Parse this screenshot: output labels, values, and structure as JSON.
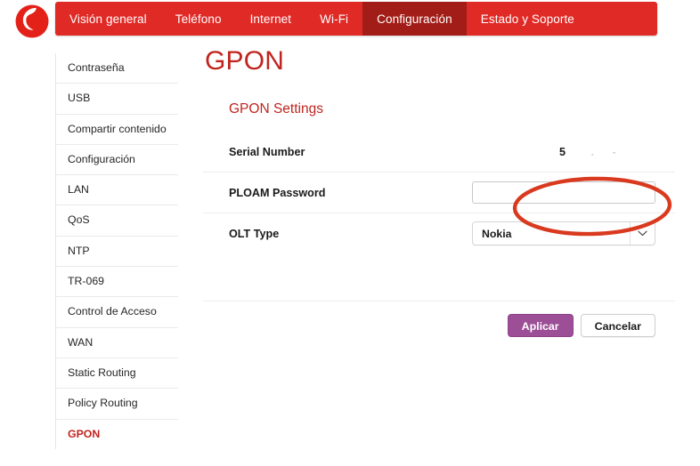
{
  "brand": {
    "logo_icon": "vodafone-speechmark-logo",
    "red": "#e02a26",
    "dark_red": "#a31d18",
    "title_red": "#c0241f",
    "purple": "#9c4e96",
    "annotation_red": "#d93a1f"
  },
  "nav": {
    "items": [
      {
        "label": "Visión general",
        "active": false
      },
      {
        "label": "Teléfono",
        "active": false
      },
      {
        "label": "Internet",
        "active": false
      },
      {
        "label": "Wi-Fi",
        "active": false
      },
      {
        "label": "Configuración",
        "active": true
      },
      {
        "label": "Estado y Soporte",
        "active": false
      }
    ]
  },
  "sidebar": {
    "items": [
      {
        "label": "Contraseña",
        "selected": false
      },
      {
        "label": "USB",
        "selected": false
      },
      {
        "label": "Compartir contenido",
        "selected": false
      },
      {
        "label": "Configuración",
        "selected": false
      },
      {
        "label": "LAN",
        "selected": false
      },
      {
        "label": "QoS",
        "selected": false
      },
      {
        "label": "NTP",
        "selected": false
      },
      {
        "label": "TR-069",
        "selected": false
      },
      {
        "label": "Control de Acceso",
        "selected": false
      },
      {
        "label": "WAN",
        "selected": false
      },
      {
        "label": "Static Routing",
        "selected": false
      },
      {
        "label": "Policy Routing",
        "selected": false
      },
      {
        "label": "GPON",
        "selected": true
      }
    ]
  },
  "main": {
    "page_title": "GPON",
    "section_title": "GPON Settings",
    "rows": {
      "serial": {
        "label": "Serial Number",
        "value": "5",
        "value_note": "mostly erased / redacted"
      },
      "ploam": {
        "label": "PLOAM Password",
        "value": "",
        "placeholder": ""
      },
      "olt": {
        "label": "OLT Type",
        "value": "Nokia",
        "arrow_icon": "chevron-down-icon"
      }
    },
    "buttons": {
      "apply": "Aplicar",
      "cancel": "Cancelar"
    },
    "annotation": {
      "shape": "hand-drawn-red-ellipse",
      "targets": "ploam-password-input"
    }
  }
}
